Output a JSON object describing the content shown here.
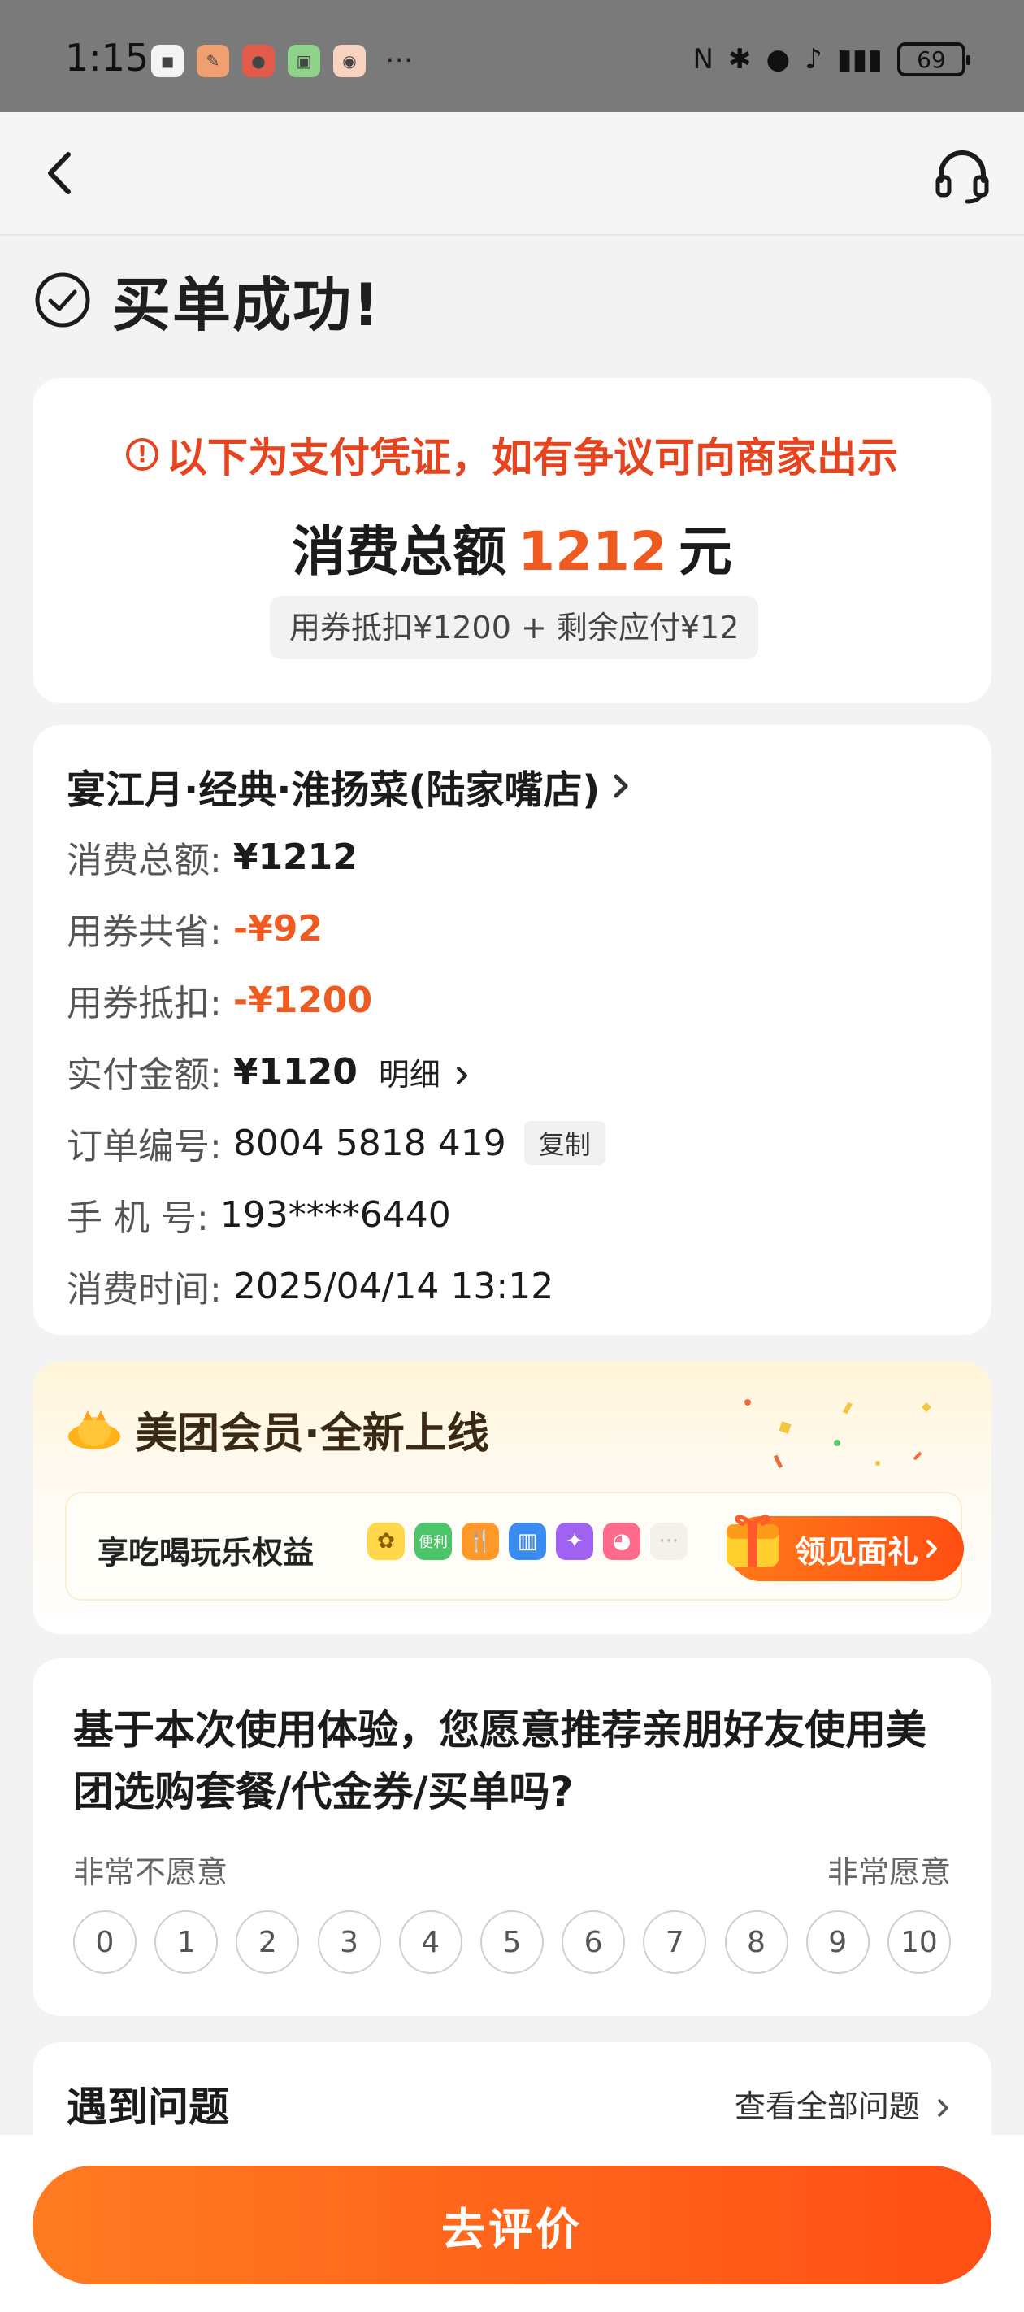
{
  "status_bar": {
    "time": "1:15",
    "more": "···",
    "battery": "69"
  },
  "success": {
    "title": "买单成功!"
  },
  "voucher": {
    "notice": "以下为支付凭证，如有争议可向商家出示",
    "total_label": "消费总额",
    "total_amount": "1212",
    "total_unit": "元",
    "deduct_text": "用券抵扣¥1200 + 剩余应付¥12"
  },
  "order": {
    "shop_name": "宴江月·经典·淮扬菜(陆家嘴店)",
    "rows": {
      "total_label": "消费总额:",
      "total_value": "¥1212",
      "saved_label": "用券共省:",
      "saved_value": "-¥92",
      "deduct_label": "用券抵扣:",
      "deduct_value": "-¥1200",
      "paid_label": "实付金额:",
      "paid_value": "¥1120",
      "detail_label": "明细",
      "order_no_label": "订单编号:",
      "order_no_value": "8004 5818 419",
      "copy_label": "复制",
      "phone_label": "手 机 号:",
      "phone_value": "193****6440",
      "time_label": "消费时间:",
      "time_value": "2025/04/14 13:12"
    }
  },
  "membership": {
    "title": "美团会员·全新上线",
    "benefit": "享吃喝玩乐权益",
    "benefit_icon_names": [
      "bunny-icon",
      "convenience-icon",
      "dining-icon",
      "hotel-icon",
      "game-icon",
      "octopus-icon",
      "more-icon"
    ],
    "convenience_tag": "便利",
    "gift_button": "领见面礼"
  },
  "nps": {
    "question": "基于本次使用体验，您愿意推荐亲朋好友使用美团选购套餐/代金券/买单吗?",
    "low_label": "非常不愿意",
    "high_label": "非常愿意",
    "scale": [
      "0",
      "1",
      "2",
      "3",
      "4",
      "5",
      "6",
      "7",
      "8",
      "9",
      "10"
    ]
  },
  "problems": {
    "title": "遇到问题",
    "link": "查看全部问题"
  },
  "bottom": {
    "review_button": "去评价"
  },
  "colors": {
    "accent_orange": "#ee5a1f",
    "notice_red": "#e6431f",
    "status_bar": "#7a7a7a"
  }
}
